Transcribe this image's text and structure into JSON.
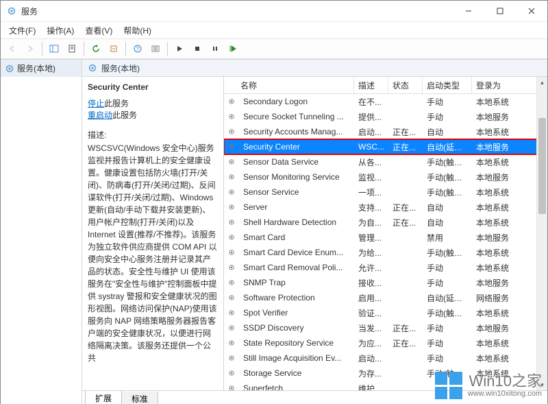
{
  "window": {
    "title": "服务"
  },
  "menus": {
    "file": "文件(F)",
    "action": "操作(A)",
    "view": "查看(V)",
    "help": "帮助(H)"
  },
  "tree": {
    "root": "服务(本地)"
  },
  "rp_header": "服务(本地)",
  "detail": {
    "selected_name": "Security Center",
    "stop_link": "停止",
    "stop_suffix": "此服务",
    "restart_link": "重启动",
    "restart_suffix": "此服务",
    "desc_label": "描述:",
    "desc_text": "WSCSVC(Windows 安全中心)服务监视并报告计算机上的安全健康设置。健康设置包括防火墙(打开/关闭)、防病毒(打开/关闭/过期)、反间谍软件(打开/关闭/过期)、Windows 更新(自动/手动下载并安装更新)、用户帐户控制(打开/关闭)以及 Internet 设置(推荐/不推荐)。该服务为独立软件供应商提供 COM API 以便向安全中心服务注册并记录其产品的状态。安全性与维护 UI 使用该服务在\"安全性与维护\"控制面板中提供 systray 警报和安全健康状况的图形视图。网络访问保护(NAP)使用该服务向 NAP 网络策略服务器报告客户端的安全健康状况，以便进行网络隔离决策。该服务还提供一个公共"
  },
  "columns": {
    "name": "名称",
    "desc": "描述",
    "status": "状态",
    "type": "启动类型",
    "account": "登录为"
  },
  "rows": [
    {
      "name": "Secondary Logon",
      "desc": "在不...",
      "status": "",
      "type": "手动",
      "account": "本地系统"
    },
    {
      "name": "Secure Socket Tunneling ...",
      "desc": "提供...",
      "status": "",
      "type": "手动",
      "account": "本地服务"
    },
    {
      "name": "Security Accounts Manag...",
      "desc": "启动...",
      "status": "正在...",
      "type": "自动",
      "account": "本地系统"
    },
    {
      "name": "Security Center",
      "desc": "WSC...",
      "status": "正在...",
      "type": "自动(延迟...",
      "account": "本地服务",
      "selected": true,
      "boxed": true
    },
    {
      "name": "Sensor Data Service",
      "desc": "从各...",
      "status": "",
      "type": "手动(触发...",
      "account": "本地系统"
    },
    {
      "name": "Sensor Monitoring Service",
      "desc": "监视...",
      "status": "",
      "type": "手动(触发...",
      "account": "本地服务"
    },
    {
      "name": "Sensor Service",
      "desc": "一项...",
      "status": "",
      "type": "手动(触发...",
      "account": "本地系统"
    },
    {
      "name": "Server",
      "desc": "支持...",
      "status": "正在...",
      "type": "自动",
      "account": "本地系统"
    },
    {
      "name": "Shell Hardware Detection",
      "desc": "为自...",
      "status": "正在...",
      "type": "自动",
      "account": "本地系统"
    },
    {
      "name": "Smart Card",
      "desc": "管理...",
      "status": "",
      "type": "禁用",
      "account": "本地服务"
    },
    {
      "name": "Smart Card Device Enum...",
      "desc": "为给...",
      "status": "",
      "type": "手动(触发...",
      "account": "本地系统"
    },
    {
      "name": "Smart Card Removal Poli...",
      "desc": "允许...",
      "status": "",
      "type": "手动",
      "account": "本地系统"
    },
    {
      "name": "SNMP Trap",
      "desc": "接收...",
      "status": "",
      "type": "手动",
      "account": "本地服务"
    },
    {
      "name": "Software Protection",
      "desc": "启用...",
      "status": "",
      "type": "自动(延迟...",
      "account": "网络服务"
    },
    {
      "name": "Spot Verifier",
      "desc": "验证...",
      "status": "",
      "type": "手动(触发...",
      "account": "本地系统"
    },
    {
      "name": "SSDP Discovery",
      "desc": "当发...",
      "status": "正在...",
      "type": "手动",
      "account": "本地服务"
    },
    {
      "name": "State Repository Service",
      "desc": "为应...",
      "status": "正在...",
      "type": "手动",
      "account": "本地系统"
    },
    {
      "name": "Still Image Acquisition Ev...",
      "desc": "启动...",
      "status": "",
      "type": "手动",
      "account": "本地系统"
    },
    {
      "name": "Storage Service",
      "desc": "为存...",
      "status": "",
      "type": "手动(触发...",
      "account": "本地系统"
    },
    {
      "name": "Superfetch",
      "desc": "维护...",
      "status": "",
      "type": "",
      "account": ""
    }
  ],
  "tabs": {
    "extended": "扩展",
    "standard": "标准"
  },
  "watermark": {
    "line1a": "Win10",
    "line1b": "之家",
    "line2": "www.win10xitong.com"
  }
}
